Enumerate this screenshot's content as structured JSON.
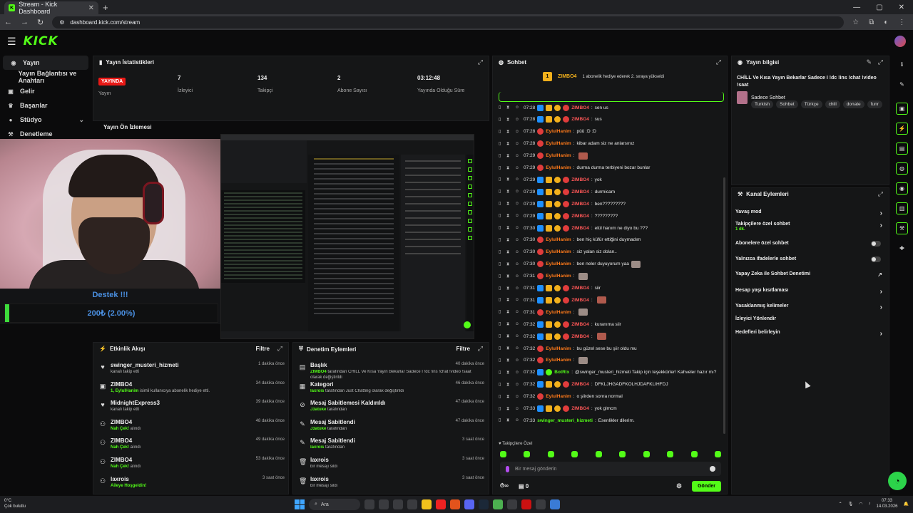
{
  "browser": {
    "tab_title": "Stream - Kick Dashboard",
    "url": "dashboard.kick.com/stream"
  },
  "brand": {
    "logo": "KICK",
    "accent": "#53fc18"
  },
  "sidebar": {
    "items": [
      {
        "label": "Yayın",
        "icon": "broadcast-icon"
      },
      {
        "label": "Yayın Bağlantısı ve Anahtarı",
        "icon": "key-icon"
      },
      {
        "label": "Gelir",
        "icon": "wallet-icon"
      },
      {
        "label": "Başarılar",
        "icon": "trophy-icon"
      },
      {
        "label": "Stüdyo",
        "icon": "studio-icon"
      },
      {
        "label": "Denetleme",
        "icon": "gavel-icon"
      }
    ]
  },
  "donation": {
    "title": "Destek !!!",
    "amount": "200₺ (2.00%)",
    "progress_percent": 2
  },
  "stats": {
    "title": "Yayın İstatistikleri",
    "live_badge": "YAYINDA",
    "live_label": "Yayın",
    "viewers": "7",
    "viewers_label": "İzleyici",
    "followers": "134",
    "followers_label": "Takipçi",
    "subs": "2",
    "subs_label": "Abone Sayısı",
    "uptime": "03:12:48",
    "uptime_label": "Yayında Olduğu Süre"
  },
  "preview": {
    "title": "Yayın Ön İzlemesi"
  },
  "events": {
    "title": "Etkinlik Akışı",
    "filter": "Filtre",
    "items": [
      {
        "name": "swinger_musteri_hizmeti",
        "desc": "kanalı takip etti",
        "highlight": "",
        "time": "1 dakika önce",
        "icon": "heart-icon"
      },
      {
        "name": "ZIMBO4",
        "desc": " isimli kullanıcıya abonelik hediye etti.",
        "highlight": "1, EylulHanim",
        "time": "34 dakika önce",
        "icon": "gift-icon"
      },
      {
        "name": "MidnightExpress3",
        "desc": "kanalı takip etti",
        "highlight": "",
        "time": "39 dakika önce",
        "icon": "heart-icon"
      },
      {
        "name": "ZIMBO4",
        "desc": " alındı",
        "highlight": "Nah Çek!",
        "time": "48 dakika önce",
        "icon": "points-icon"
      },
      {
        "name": "ZIMBO4",
        "desc": " alındı",
        "highlight": "Nah Çek!",
        "time": "49 dakika önce",
        "icon": "points-icon"
      },
      {
        "name": "ZIMBO4",
        "desc": " alındı",
        "highlight": "Nah Çek!",
        "time": "53 dakika önce",
        "icon": "points-icon"
      },
      {
        "name": "laxrois",
        "desc": "",
        "highlight": "Aileye Hoşgeldin!",
        "time": "3 saat önce",
        "icon": "points-icon"
      }
    ]
  },
  "modlog": {
    "title": "Denetim Eylemleri",
    "filter": "Filtre",
    "items": [
      {
        "name": "Başlık",
        "actor": "ZIMBO4",
        "desc": " tarafından CHİLL Ve Kısa Yayın Bekarlar Sadece I !dc !ins !chat !video !saat",
        "desc2": "olarak değiştirildi",
        "time": "40 dakika önce",
        "icon": "title-icon"
      },
      {
        "name": "Kategori",
        "actor": "laxrois",
        "desc": " tarafından Just Chatting olarak değiştirildi",
        "desc2": "",
        "time": "46 dakika önce",
        "icon": "category-icon"
      },
      {
        "name": "Mesaj Sabitlemesi Kaldırıldı",
        "actor": "J3atuke",
        "desc": " tarafından",
        "desc2": "",
        "time": "47 dakika önce",
        "icon": "unpin-icon"
      },
      {
        "name": "Mesaj Sabitlendi",
        "actor": "J3atuke",
        "desc": " tarafından",
        "desc2": "",
        "time": "47 dakika önce",
        "icon": "pin-icon"
      },
      {
        "name": "Mesaj Sabitlendi",
        "actor": "laxrois",
        "desc": " tarafından",
        "desc2": "",
        "time": "3 saat önce",
        "icon": "pin-icon"
      },
      {
        "name": "laxrois",
        "actor": "",
        "desc": "bir mesajı sildi",
        "desc2": "",
        "time": "3 saat önce",
        "icon": "trash-icon"
      },
      {
        "name": "laxrois",
        "actor": "",
        "desc": "bir mesajı sildi",
        "desc2": "",
        "time": "3 saat önce",
        "icon": "trash-icon"
      }
    ]
  },
  "chat": {
    "title": "Sohbet",
    "top_user": "ZIMBO4",
    "top_rank": "1",
    "top_msg": "1 abonelik hediye ederek 2. sıraya yükseldi",
    "messages": [
      {
        "time": "07:28",
        "user": "ZIMBO4",
        "cls": "u-z",
        "text": "sen us",
        "emote": ""
      },
      {
        "time": "07:28",
        "user": "ZIMBO4",
        "cls": "u-z",
        "text": "sus",
        "emote": ""
      },
      {
        "time": "07:28",
        "user": "EylulHanim",
        "cls": "u-e",
        "text": "püü :D :D",
        "emote": ""
      },
      {
        "time": "07:28",
        "user": "EylulHanim",
        "cls": "u-e",
        "text": "kibar adam siz ne anlarsınız",
        "emote": ""
      },
      {
        "time": "07:29",
        "user": "EylulHanim",
        "cls": "u-e",
        "text": "",
        "emote": "r"
      },
      {
        "time": "07:29",
        "user": "EylulHanim",
        "cls": "u-e",
        "text": "durma durma terbiyeni bozar bunlar",
        "emote": ""
      },
      {
        "time": "07:29",
        "user": "ZIMBO4",
        "cls": "u-z",
        "text": "yok",
        "emote": ""
      },
      {
        "time": "07:29",
        "user": "ZIMBO4",
        "cls": "u-z",
        "text": "durmicam",
        "emote": ""
      },
      {
        "time": "07:29",
        "user": "ZIMBO4",
        "cls": "u-z",
        "text": "ben?????????",
        "emote": ""
      },
      {
        "time": "07:29",
        "user": "ZIMBO4",
        "cls": "u-z",
        "text": "?????????",
        "emote": ""
      },
      {
        "time": "07:30",
        "user": "ZIMBO4",
        "cls": "u-z",
        "text": "elül hanım ne diyo bu ???",
        "emote": ""
      },
      {
        "time": "07:30",
        "user": "EylulHanim",
        "cls": "u-e",
        "text": "ben hiç küfür ettiğini duymadım",
        "emote": ""
      },
      {
        "time": "07:30",
        "user": "EylulHanim",
        "cls": "u-e",
        "text": "siz yalan siz dolan..",
        "emote": ""
      },
      {
        "time": "07:30",
        "user": "EylulHanim",
        "cls": "u-e",
        "text": "ben neler duyuyorum yaa",
        "emote": "g"
      },
      {
        "time": "07:31",
        "user": "EylulHanim",
        "cls": "u-e",
        "text": "",
        "emote": "g"
      },
      {
        "time": "07:31",
        "user": "ZIMBO4",
        "cls": "u-z",
        "text": "siir",
        "emote": ""
      },
      {
        "time": "07:31",
        "user": "ZIMBO4",
        "cls": "u-z",
        "text": "",
        "emote": "r"
      },
      {
        "time": "07:31",
        "user": "EylulHanim",
        "cls": "u-e",
        "text": "",
        "emote": "g"
      },
      {
        "time": "07:32",
        "user": "ZIMBO4",
        "cls": "u-z",
        "text": "kuranıma siir",
        "emote": ""
      },
      {
        "time": "07:32",
        "user": "ZIMBO4",
        "cls": "u-z",
        "text": "",
        "emote": "r"
      },
      {
        "time": "07:32",
        "user": "EylulHanim",
        "cls": "u-e",
        "text": "bu güzel sese bu şiir oldu mu",
        "emote": ""
      },
      {
        "time": "07:32",
        "user": "EylulHanim",
        "cls": "u-e",
        "text": "",
        "emote": "g"
      },
      {
        "time": "07:32",
        "user": "BotRix",
        "cls": "u-b",
        "text": "@swinger_musteri_hizmeti Takip için teşekkürler! Kahveler hazır mı?",
        "emote": ""
      },
      {
        "time": "07:32",
        "user": "ZIMBO4",
        "cls": "u-z",
        "text": "DFKLJHGADFKOLHJDAFKLIHFDJ",
        "emote": ""
      },
      {
        "time": "07:32",
        "user": "EylulHanim",
        "cls": "u-e",
        "text": "o şiirden sonra normal",
        "emote": ""
      },
      {
        "time": "07:33",
        "user": "ZIMBO4",
        "cls": "u-z",
        "text": "yok glmcm",
        "emote": ""
      },
      {
        "time": "07:33",
        "user": "swinger_musteri_hizmeti",
        "cls": "u-s",
        "text": "Esenlikler dilerim.",
        "emote": ""
      }
    ],
    "followers_only": "Takipçilere Özel",
    "input_placeholder": "Bir mesaj gönderin",
    "points": "0",
    "send": "Gönder"
  },
  "info": {
    "title": "Yayın bilgisi",
    "stream_title": "CHİLL Ve Kısa Yayın Bekarlar Sadece I !dc !ins !chat !video !saat",
    "category": "Sadece Sohbet",
    "tags": [
      "Turkish",
      "Sohbet",
      "Türkçe",
      "chill",
      "donate",
      "funr"
    ]
  },
  "actions": {
    "title": "Kanal Eylemleri",
    "items": [
      {
        "label": "Yavaş mod",
        "sub": "",
        "ctrl": "chev"
      },
      {
        "label": "Takipçilere özel sohbet",
        "sub": "1 dk.",
        "ctrl": "chev"
      },
      {
        "label": "Abonelere özel sohbet",
        "sub": "",
        "ctrl": "tog"
      },
      {
        "label": "Yalnızca ifadelerle sohbet",
        "sub": "",
        "ctrl": "tog"
      },
      {
        "label": "Yapay Zeka ile Sohbet Denetimi",
        "sub": "",
        "ctrl": "ext"
      },
      {
        "label": "Hesap yaşı kısıtlaması",
        "sub": "",
        "ctrl": "chev"
      },
      {
        "label": "Yasaklanmış kelimeler",
        "sub": "",
        "ctrl": "chev"
      },
      {
        "label": "İzleyici Yönlendir",
        "sub": "",
        "ctrl": ""
      },
      {
        "label": "Hedefleri belirleyin",
        "sub": "",
        "ctrl": "chev"
      }
    ]
  },
  "taskbar": {
    "weather_temp": "0°C",
    "weather_desc": "Çok bulutlu",
    "search": "Ara",
    "time": "07:33",
    "date": "14.03.2026"
  }
}
